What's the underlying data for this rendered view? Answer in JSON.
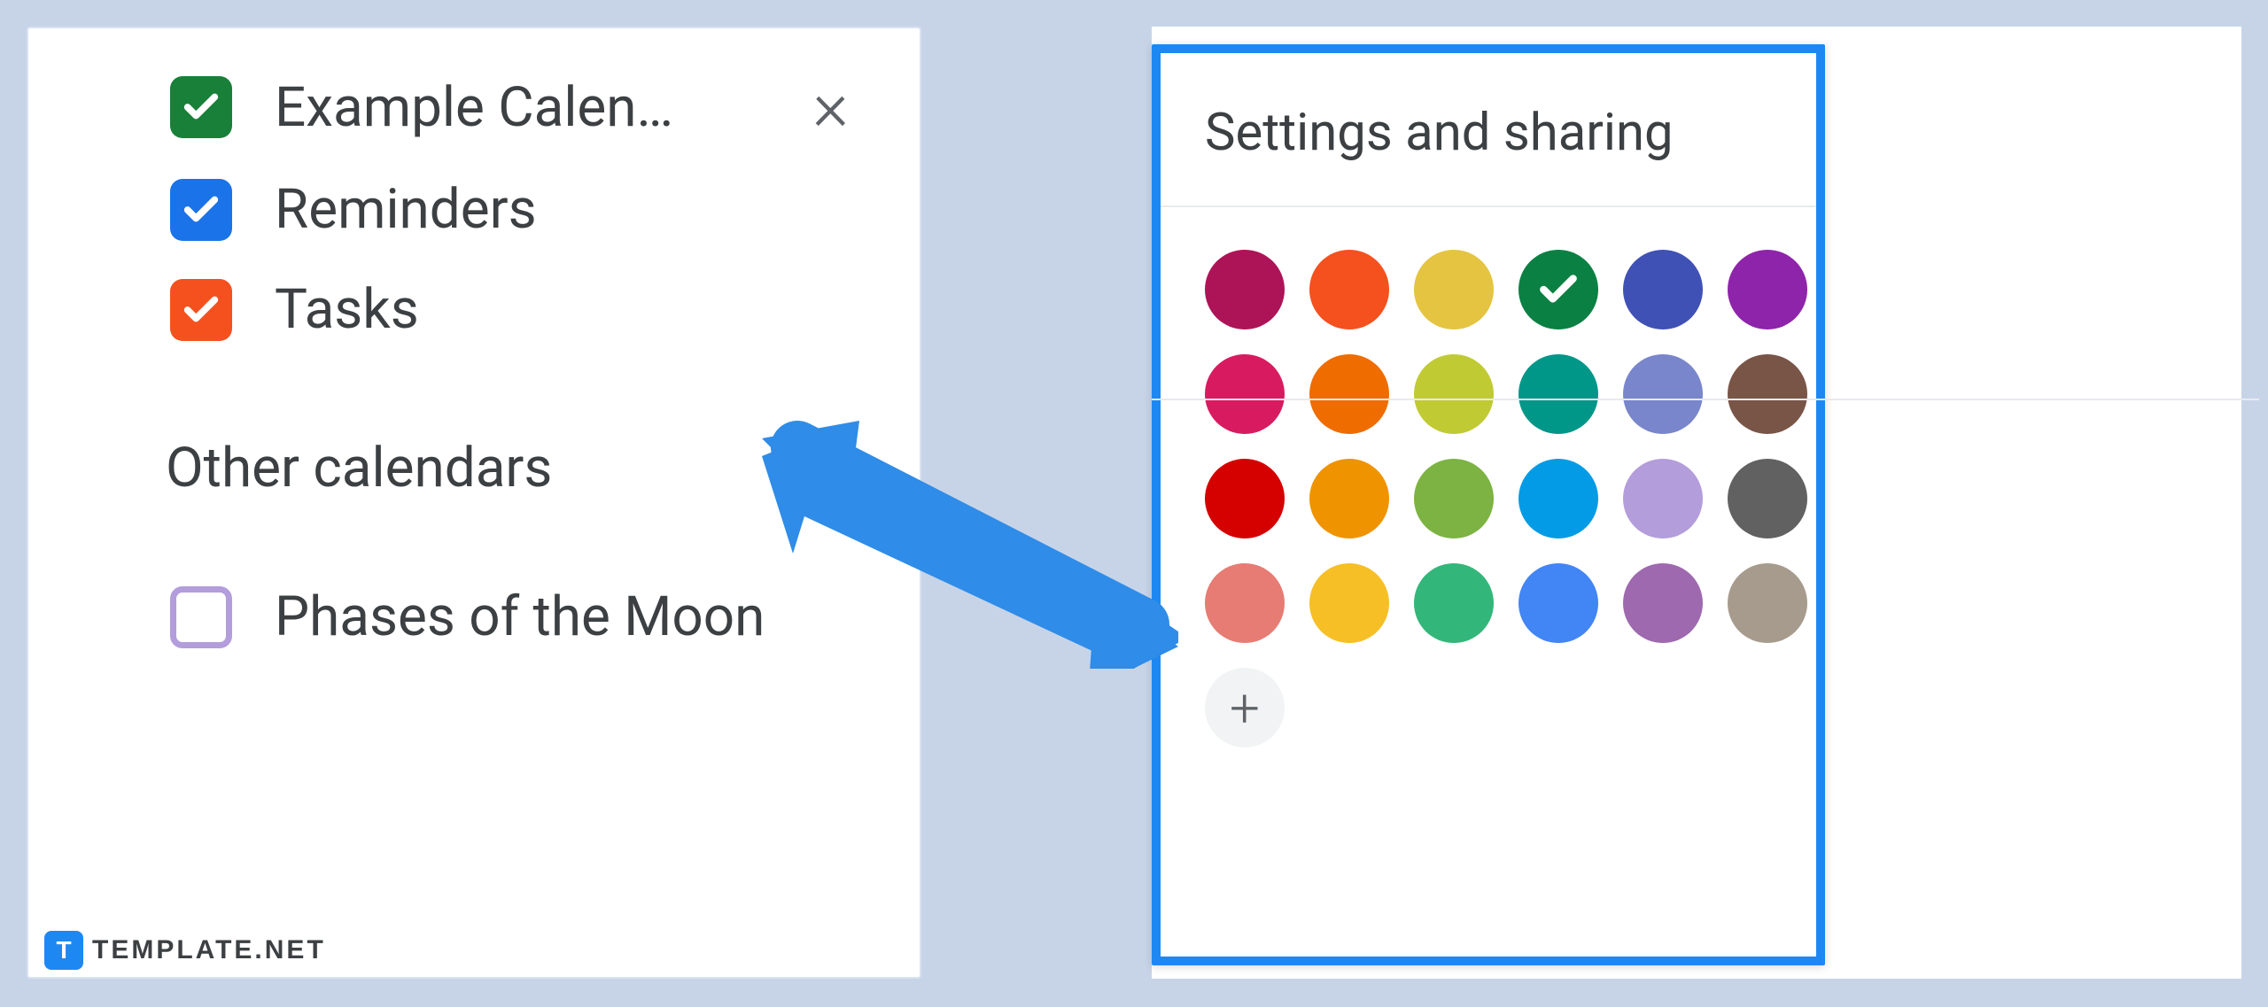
{
  "sidebar": {
    "calendars": [
      {
        "label": "Example Calen…",
        "color": "#188038",
        "checked": true,
        "showClose": true
      },
      {
        "label": "Reminders",
        "color": "#1a73e8",
        "checked": true,
        "showClose": false
      },
      {
        "label": "Tasks",
        "color": "#f4511e",
        "checked": true,
        "showClose": false
      }
    ],
    "otherSection": {
      "title": "Other calendars"
    },
    "otherCalendars": [
      {
        "label": "Phases of the Moon",
        "color": "#b39ddb",
        "checked": false
      }
    ]
  },
  "popover": {
    "title": "Settings and sharing",
    "selectedIndex": 3,
    "colors": [
      "#ad1457",
      "#f4511e",
      "#e4c441",
      "#0b8043",
      "#3f51b5",
      "#8e24aa",
      "#d81b60",
      "#ef6c00",
      "#c0ca33",
      "#009688",
      "#7986cb",
      "#795548",
      "#d50000",
      "#f09300",
      "#7cb342",
      "#039be5",
      "#b39ddb",
      "#616161",
      "#e67c73",
      "#f6bf26",
      "#33b679",
      "#4285f4",
      "#9e69af",
      "#a79b8e"
    ]
  },
  "watermark": {
    "iconLetter": "T",
    "text": "TEMPLATE.NET"
  }
}
